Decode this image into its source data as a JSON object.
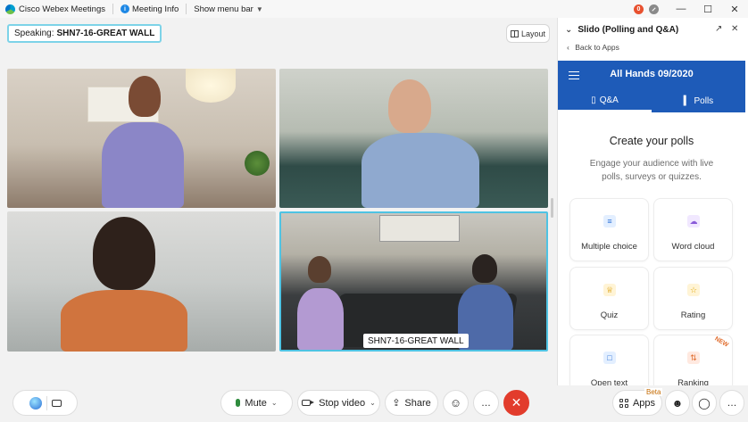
{
  "titlebar": {
    "app_name": "Cisco Webex Meetings",
    "meeting_info": "Meeting Info",
    "menu_bar": "Show menu bar",
    "notification_count": "0"
  },
  "speaking": {
    "prefix": "Speaking:",
    "name": "SHN7-16-GREAT WALL"
  },
  "layout": {
    "label": "Layout"
  },
  "tiles": [
    {
      "label": ""
    },
    {
      "label": ""
    },
    {
      "label": ""
    },
    {
      "label": "SHN7-16-GREAT WALL"
    }
  ],
  "toolbar": {
    "mute": "Mute",
    "stop_video": "Stop video",
    "share": "Share",
    "more": "…",
    "end": "✕",
    "apps": "Apps",
    "beta": "Beta"
  },
  "slido": {
    "title": "Slido (Polling and Q&A)",
    "back": "Back to Apps",
    "event": "All Hands 09/2020",
    "tabs": [
      {
        "label": "Q&A"
      },
      {
        "label": "Polls"
      }
    ],
    "heading": "Create your polls",
    "subheading": "Engage your audience with live polls, surveys or quizzes.",
    "cards": [
      {
        "label": "Multiple choice"
      },
      {
        "label": "Word cloud"
      },
      {
        "label": "Quiz"
      },
      {
        "label": "Rating"
      },
      {
        "label": "Open text"
      },
      {
        "label": "Ranking",
        "tag": "NEW"
      }
    ]
  },
  "colors": {
    "accent_blue": "#1e5bb8",
    "speaker_border": "#7dd3e8",
    "end_call_red": "#e23c2c"
  }
}
